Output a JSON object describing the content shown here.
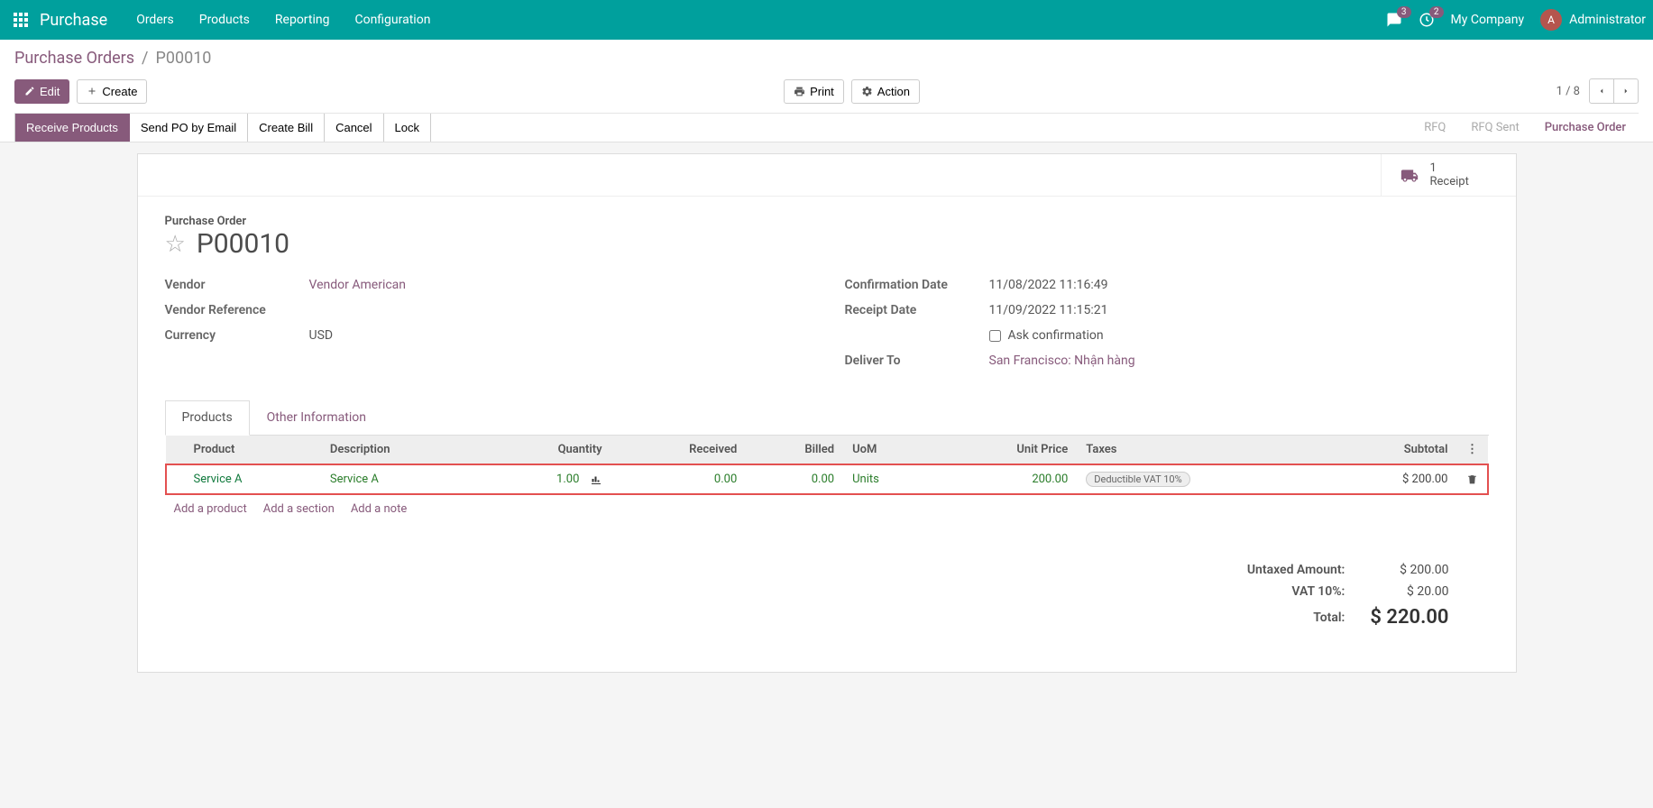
{
  "navbar": {
    "brand": "Purchase",
    "menu": [
      "Orders",
      "Products",
      "Reporting",
      "Configuration"
    ],
    "messages_badge": "3",
    "activities_badge": "2",
    "company": "My Company",
    "user_initial": "A",
    "user_name": "Administrator"
  },
  "breadcrumb": {
    "parent": "Purchase Orders",
    "current": "P00010"
  },
  "buttons": {
    "edit": "Edit",
    "create": "Create",
    "print": "Print",
    "action": "Action"
  },
  "pager": {
    "counter": "1 / 8"
  },
  "status_buttons": [
    "Receive Products",
    "Send PO by Email",
    "Create Bill",
    "Cancel",
    "Lock"
  ],
  "status_steps": [
    "RFQ",
    "RFQ Sent",
    "Purchase Order"
  ],
  "stat_button": {
    "count": "1",
    "label": "Receipt"
  },
  "record": {
    "label": "Purchase Order",
    "name": "P00010",
    "vendor_label": "Vendor",
    "vendor": "Vendor American",
    "vendor_ref_label": "Vendor Reference",
    "vendor_ref": "",
    "currency_label": "Currency",
    "currency": "USD",
    "confirmation_label": "Confirmation Date",
    "confirmation": "11/08/2022 11:16:49",
    "receipt_label": "Receipt Date",
    "receipt": "11/09/2022 11:15:21",
    "ask_confirm_label": "Ask confirmation",
    "deliver_to_label": "Deliver To",
    "deliver_to": "San Francisco: Nhận hàng"
  },
  "tabs": [
    "Products",
    "Other Information"
  ],
  "columns": {
    "product": "Product",
    "description": "Description",
    "quantity": "Quantity",
    "received": "Received",
    "billed": "Billed",
    "uom": "UoM",
    "unit_price": "Unit Price",
    "taxes": "Taxes",
    "subtotal": "Subtotal"
  },
  "line": {
    "product": "Service A",
    "description": "Service A",
    "quantity": "1.00",
    "received": "0.00",
    "billed": "0.00",
    "uom": "Units",
    "unit_price": "200.00",
    "tax": "Deductible VAT 10%",
    "subtotal": "$ 200.00"
  },
  "add_links": {
    "product": "Add a product",
    "section": "Add a section",
    "note": "Add a note"
  },
  "totals": {
    "untaxed_label": "Untaxed Amount:",
    "untaxed": "$ 200.00",
    "vat_label": "VAT 10%:",
    "vat": "$ 20.00",
    "total_label": "Total:",
    "total": "$ 220.00"
  }
}
